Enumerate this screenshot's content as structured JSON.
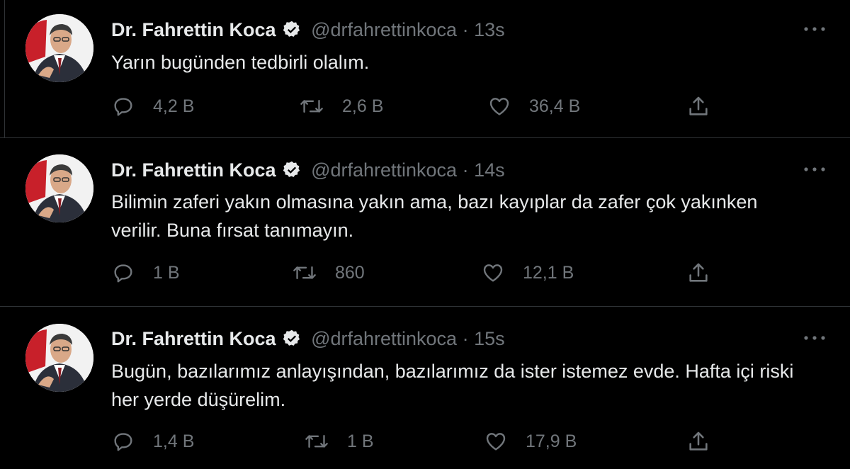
{
  "tweets": [
    {
      "name": "Dr. Fahrettin Koca",
      "handle": "@drfahrettinkoca",
      "separator": "·",
      "time": "13s",
      "text": "Yarın bugünden tedbirli olalım.",
      "replies": "4,2 B",
      "retweets": "2,6 B",
      "likes": "36,4 B"
    },
    {
      "name": "Dr. Fahrettin Koca",
      "handle": "@drfahrettinkoca",
      "separator": "·",
      "time": "14s",
      "text": "Bilimin zaferi yakın olmasına yakın ama, bazı kayıplar da zafer çok yakınken verilir. Buna fırsat tanımayın.",
      "replies": "1 B",
      "retweets": "860",
      "likes": "12,1 B"
    },
    {
      "name": "Dr. Fahrettin Koca",
      "handle": "@drfahrettinkoca",
      "separator": "·",
      "time": "15s",
      "text": "Bugün, bazılarımız anlayışından, bazılarımız da ister istemez evde. Hafta içi riski her yerde düşürelim.",
      "replies": "1,4 B",
      "retweets": "1 B",
      "likes": "17,9 B"
    }
  ],
  "icons": {
    "reply": "reply-icon",
    "retweet": "retweet-icon",
    "like": "heart-icon",
    "share": "share-icon",
    "verified": "verified-badge-icon",
    "more": "more-icon"
  },
  "colors": {
    "background": "#000000",
    "text": "#e7e9ea",
    "muted": "#71767b",
    "divider": "#2f3336"
  }
}
